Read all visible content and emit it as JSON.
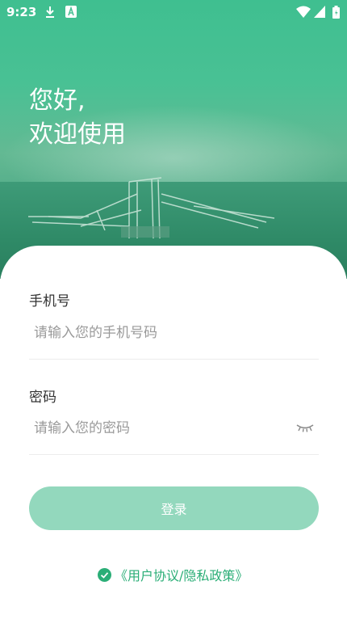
{
  "status_bar": {
    "time": "9:23",
    "icons": [
      "download-icon",
      "android-a-icon",
      "wifi-icon",
      "signal-icon",
      "battery-icon"
    ]
  },
  "greeting": {
    "line1": "您好,",
    "line2": "欢迎使用"
  },
  "form": {
    "phone": {
      "label": "手机号",
      "placeholder": "请输入您的手机号码",
      "value": ""
    },
    "password": {
      "label": "密码",
      "placeholder": "请输入您的密码",
      "value": "",
      "visibility_icon": "eye-closed-icon"
    },
    "login_label": "登录"
  },
  "agreement": {
    "checked": true,
    "text": "《用户协议/隐私政策》"
  },
  "colors": {
    "accent": "#2bae77",
    "button_disabled": "#93d8bd",
    "hero": "#4cc195"
  }
}
